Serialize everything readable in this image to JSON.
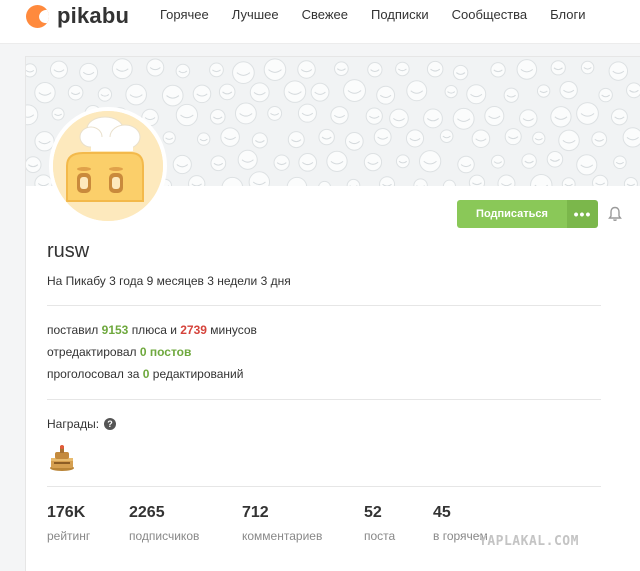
{
  "header": {
    "logo_text": "pikabu",
    "nav": [
      {
        "label": "Горячее"
      },
      {
        "label": "Лучшее"
      },
      {
        "label": "Свежее"
      },
      {
        "label": "Подписки"
      },
      {
        "label": "Сообщества"
      },
      {
        "label": "Блоги"
      }
    ]
  },
  "profile": {
    "username": "rusw",
    "since": "На Пикабу 3 года 9 месяцев 3 недели 3 дня",
    "subscribe_label": "Подписаться",
    "more_label": "•••"
  },
  "activity": {
    "line1": {
      "prefix": "поставил",
      "pluses": "9153",
      "mid1": "плюса и",
      "minuses": "2739",
      "suffix": "минусов"
    },
    "line2": {
      "prefix": "отредактировал",
      "value": "0 постов"
    },
    "line3": {
      "prefix": "проголосовал за",
      "value": "0",
      "suffix": "редактирований"
    }
  },
  "awards": {
    "label": "Награды:",
    "help_icon": "?",
    "items": [
      {
        "icon": "cake-medal-icon"
      }
    ]
  },
  "stats": [
    {
      "value": "176K",
      "label": "рейтинг"
    },
    {
      "value": "2265",
      "label": "подписчиков"
    },
    {
      "value": "712",
      "label": "комментариев"
    },
    {
      "value": "52",
      "label": "поста"
    },
    {
      "value": "45",
      "label": "в горячем"
    }
  ],
  "watermark": "YAPLAKAL.COM",
  "colors": {
    "accent_green": "#8ac858",
    "plus_green": "#6ea83d",
    "minus_red": "#d5433b",
    "logo_orange": "#ff8a3d"
  }
}
